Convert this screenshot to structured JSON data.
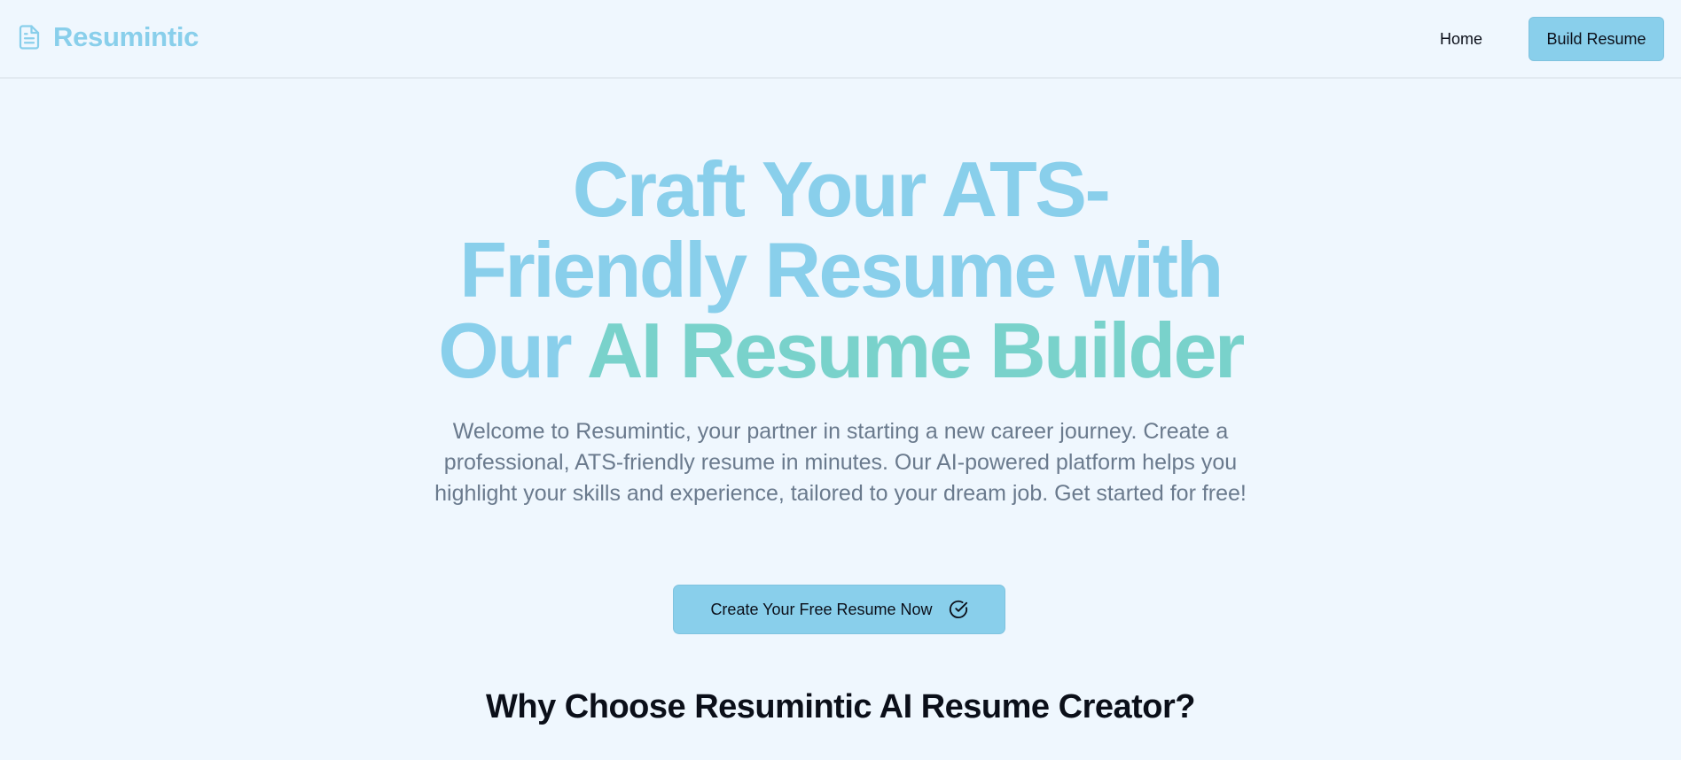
{
  "nav": {
    "brand": "Resumintic",
    "brand_icon": "document-icon",
    "home_label": "Home",
    "build_label": "Build Resume"
  },
  "hero": {
    "title_line1": "Craft Your ATS-",
    "title_line2": "Friendly Resume with",
    "title_line3_plain": "Our ",
    "title_line3_accent": "AI Resume Builder",
    "description": "Welcome to Resumintic, your partner in starting a new career journey. Create a professional, ATS-friendly resume in minutes. Our AI-powered platform helps you highlight your skills and experience, tailored to your dream job. Get started for free!",
    "cta_label": "Create Your Free Resume Now",
    "cta_icon": "check-circle-icon"
  },
  "features": {
    "title": "Why Choose Resumintic AI Resume Creator?"
  },
  "colors": {
    "background": "#eff7fe",
    "primary": "#89cfeb",
    "accent": "#79d2cb",
    "text": "#0b0f19",
    "muted": "#6a7a8d"
  }
}
